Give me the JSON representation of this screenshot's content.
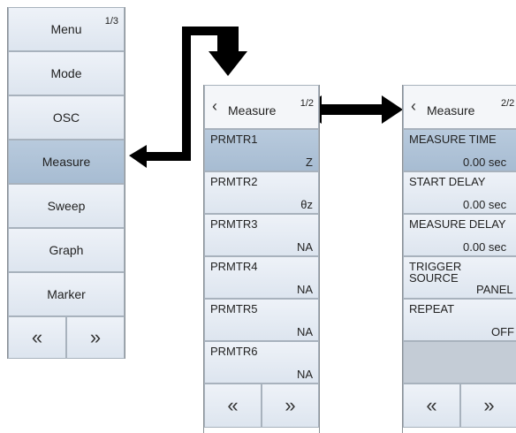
{
  "menu_panel": {
    "page_indicator": "1/3",
    "items": [
      {
        "label": "Menu"
      },
      {
        "label": "Mode"
      },
      {
        "label": "OSC"
      },
      {
        "label": "Measure"
      },
      {
        "label": "Sweep"
      },
      {
        "label": "Graph"
      },
      {
        "label": "Marker"
      }
    ],
    "nav": {
      "prev": "«",
      "next": "»"
    }
  },
  "measure_panel_1": {
    "back_icon": "‹",
    "title": "Measure",
    "page_indicator": "1/2",
    "params": [
      {
        "name": "PRMTR1",
        "value": "Z"
      },
      {
        "name": "PRMTR2",
        "value": "θz"
      },
      {
        "name": "PRMTR3",
        "value": "NA"
      },
      {
        "name": "PRMTR4",
        "value": "NA"
      },
      {
        "name": "PRMTR5",
        "value": "NA"
      },
      {
        "name": "PRMTR6",
        "value": "NA"
      }
    ],
    "nav": {
      "prev": "«",
      "next": "»"
    }
  },
  "measure_panel_2": {
    "back_icon": "‹",
    "title": "Measure",
    "page_indicator": "2/2",
    "params": [
      {
        "name": "MEASURE TIME",
        "value": "0.00 sec"
      },
      {
        "name": "START DELAY",
        "value": "0.00 sec"
      },
      {
        "name": "MEASURE DELAY",
        "value": "0.00 sec"
      },
      {
        "name_line1": "TRIGGER",
        "name_line2": "SOURCE",
        "value": "PANEL"
      },
      {
        "name": "REPEAT",
        "value": "OFF"
      }
    ],
    "nav": {
      "prev": "«",
      "next": "»"
    }
  },
  "colors": {
    "button_bg": "#dde5ef",
    "active_bg": "#a7bcd2",
    "arrow": "#000000"
  }
}
